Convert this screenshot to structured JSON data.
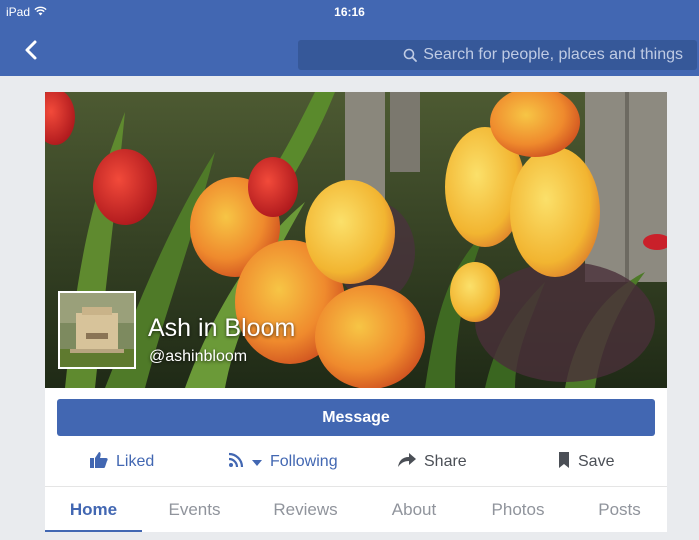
{
  "status_bar": {
    "device": "iPad",
    "time": "16:16"
  },
  "nav": {
    "search_placeholder": "Search for people, places and things"
  },
  "page": {
    "name": "Ash in Bloom",
    "handle": "@ashinbloom",
    "message_label": "Message"
  },
  "actions": {
    "liked": "Liked",
    "following": "Following",
    "share": "Share",
    "save": "Save"
  },
  "tabs": [
    {
      "label": "Home",
      "active": true
    },
    {
      "label": "Events",
      "active": false
    },
    {
      "label": "Reviews",
      "active": false
    },
    {
      "label": "About",
      "active": false
    },
    {
      "label": "Photos",
      "active": false
    },
    {
      "label": "Posts",
      "active": false
    }
  ],
  "colors": {
    "brand": "#4267b2",
    "search_bg": "#365899",
    "muted_text": "#90949c",
    "page_bg": "#e9ebee"
  },
  "icons": {
    "back": "chevron-left-icon",
    "search": "search-icon",
    "liked": "thumbs-up-icon",
    "following": "rss-icon",
    "share": "share-arrow-icon",
    "save": "bookmark-icon"
  }
}
